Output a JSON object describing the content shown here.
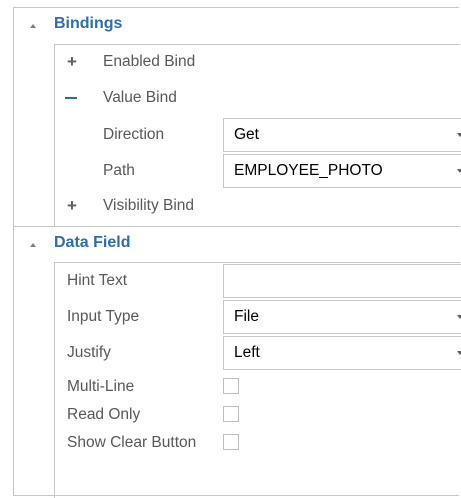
{
  "bindings": {
    "title": "Bindings",
    "enabled_bind": {
      "label": "Enabled Bind"
    },
    "value_bind": {
      "label": "Value Bind",
      "direction": {
        "label": "Direction",
        "value": "Get"
      },
      "path": {
        "label": "Path",
        "value": "EMPLOYEE_PHOTO"
      }
    },
    "visibility_bind": {
      "label": "Visibility Bind"
    }
  },
  "data_field": {
    "title": "Data Field",
    "hint_text": {
      "label": "Hint Text",
      "value": ""
    },
    "input_type": {
      "label": "Input Type",
      "value": "File"
    },
    "justify": {
      "label": "Justify",
      "value": "Left"
    },
    "multi_line": {
      "label": "Multi-Line",
      "checked": false
    },
    "read_only": {
      "label": "Read Only",
      "checked": false
    },
    "show_clear_button": {
      "label": "Show Clear Button",
      "checked": false
    }
  },
  "colors": {
    "section_title": "#2e6fa8",
    "label": "#595959",
    "border": "#c6c6c6"
  }
}
